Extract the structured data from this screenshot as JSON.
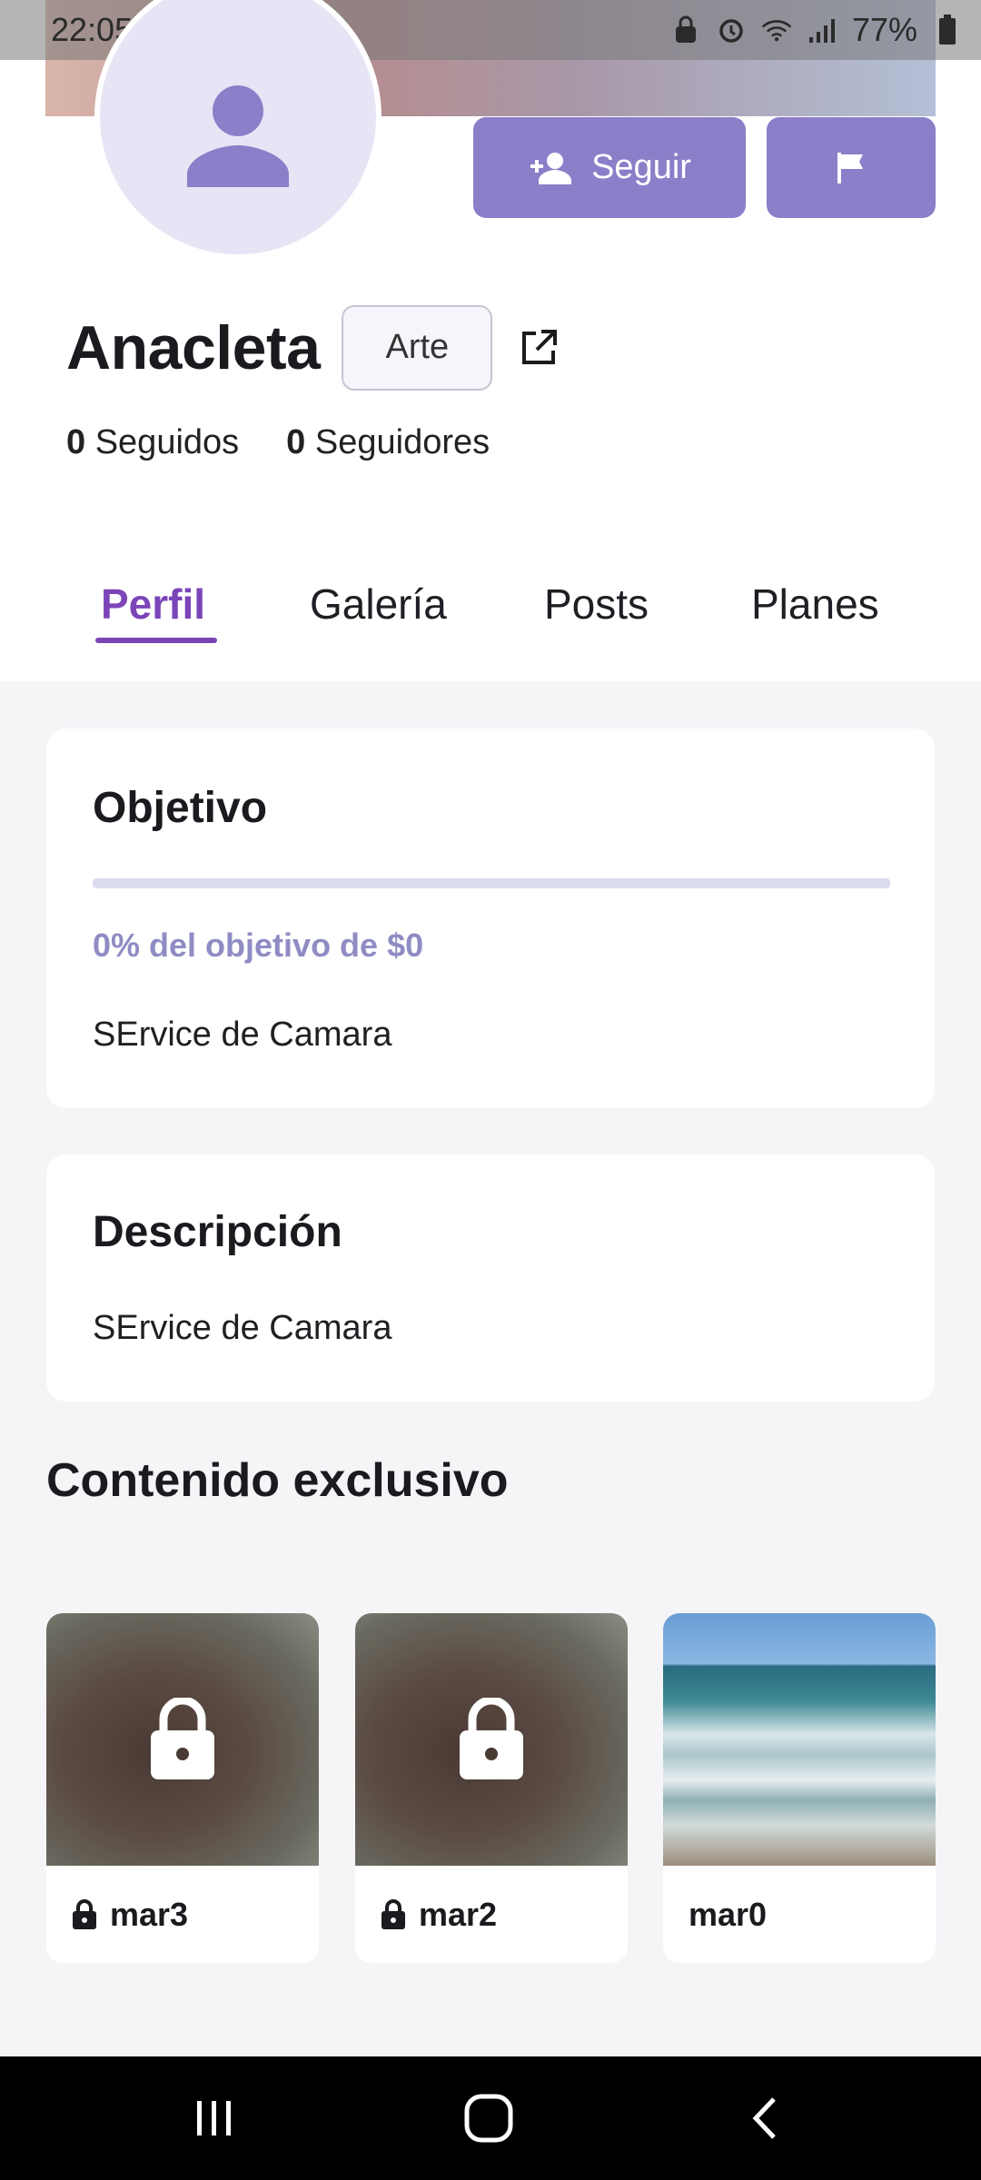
{
  "status_bar": {
    "time": "22:05",
    "battery": "77%"
  },
  "header": {
    "follow_label": "Seguir"
  },
  "profile": {
    "name": "Anacleta",
    "category": "Arte",
    "following_count": "0",
    "following_label": "Seguidos",
    "followers_count": "0",
    "followers_label": "Seguidores"
  },
  "tabs": [
    {
      "label": "Perfil",
      "active": true
    },
    {
      "label": "Galería",
      "active": false
    },
    {
      "label": "Posts",
      "active": false
    },
    {
      "label": "Planes",
      "active": false
    }
  ],
  "goal": {
    "title": "Objetivo",
    "progress_percent": 0,
    "progress_text": "0% del objetivo de $0",
    "text": "SErvice de Camara"
  },
  "description": {
    "title": "Descripción",
    "text": "SErvice de Camara"
  },
  "exclusive": {
    "title": "Contenido exclusivo",
    "items": [
      {
        "name": "mar3",
        "locked": true
      },
      {
        "name": "mar2",
        "locked": true
      },
      {
        "name": "mar0",
        "locked": false
      }
    ]
  },
  "colors": {
    "accent": "#7b45b8",
    "button": "#8c7ec8",
    "goal_text": "#8f8cc4"
  }
}
